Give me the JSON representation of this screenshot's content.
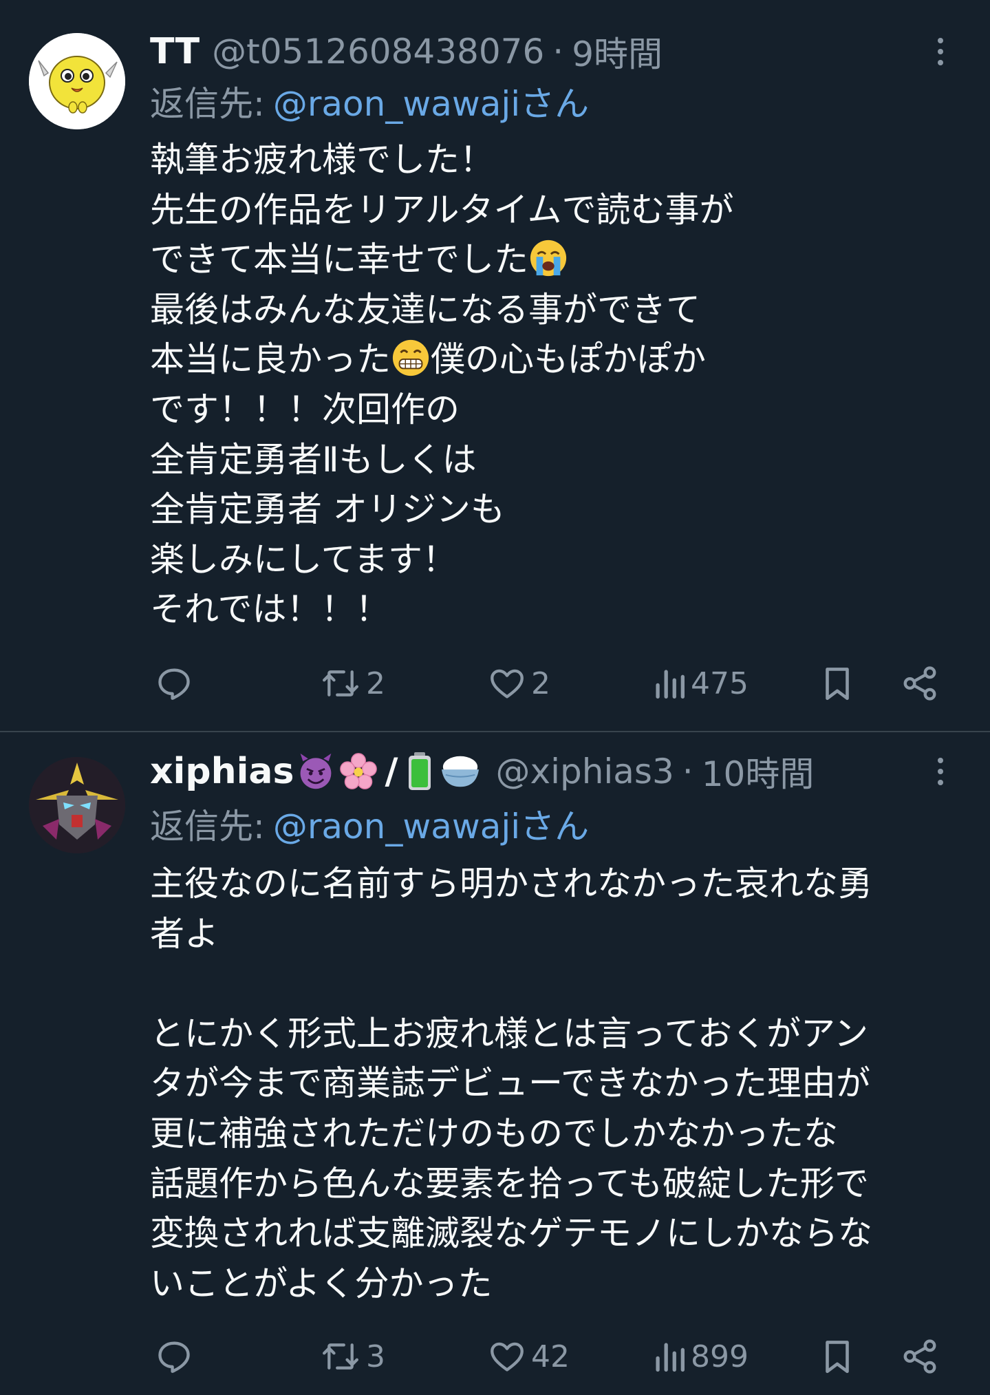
{
  "tweets": [
    {
      "display_name": "TT",
      "handle": "@t0512608438076",
      "separator": "·",
      "time": "9時間",
      "reply_prefix": "返信先:",
      "reply_to": "@raon_wawajiさん",
      "body_lines": [
        "執筆お疲れ様でした！",
        "先生の作品をリアルタイムで読む事が",
        "できて本当に幸せでした",
        "最後はみんな友達になる事ができて",
        "本当に良かった",
        "僕の心もぽかぽか",
        "です！！！次回作の",
        "全肯定勇者Ⅱもしくは",
        "全肯定勇者 オリジンも",
        "楽しみにしてます！",
        "それでは！！！"
      ],
      "emojis": [
        "loudly-crying-face",
        "grinning-face-with-smiling-eyes"
      ],
      "stats": {
        "replies": "",
        "retweets": "2",
        "likes": "2",
        "views": "475"
      }
    },
    {
      "display_name": "xiphias",
      "name_emojis": [
        "smiling-face-with-horns",
        "cherry-blossom",
        "battery",
        "cooked-rice"
      ],
      "name_slash": "/",
      "handle": "@xiphias3",
      "separator": "·",
      "time": "10時間",
      "reply_prefix": "返信先:",
      "reply_to": "@raon_wawajiさん",
      "body_lines": [
        "主役なのに名前すら明かされなかった哀れな勇",
        "者よ",
        "",
        "とにかく形式上お疲れ様とは言っておくがアン",
        "タが今まで商業誌デビューできなかった理由が",
        "更に補強されただけのものでしかなかったな",
        "話題作から色んな要素を拾っても破綻した形で",
        "変換されれば支離滅裂なゲテモノにしかならな",
        "いことがよく分かった"
      ],
      "stats": {
        "replies": "",
        "retweets": "3",
        "likes": "42",
        "views": "899"
      }
    }
  ],
  "colors": {
    "background": "#15202b",
    "text": "#f7f9f9",
    "secondary": "#8b98a5",
    "link": "#6aa9e6",
    "divider": "#38444d"
  }
}
